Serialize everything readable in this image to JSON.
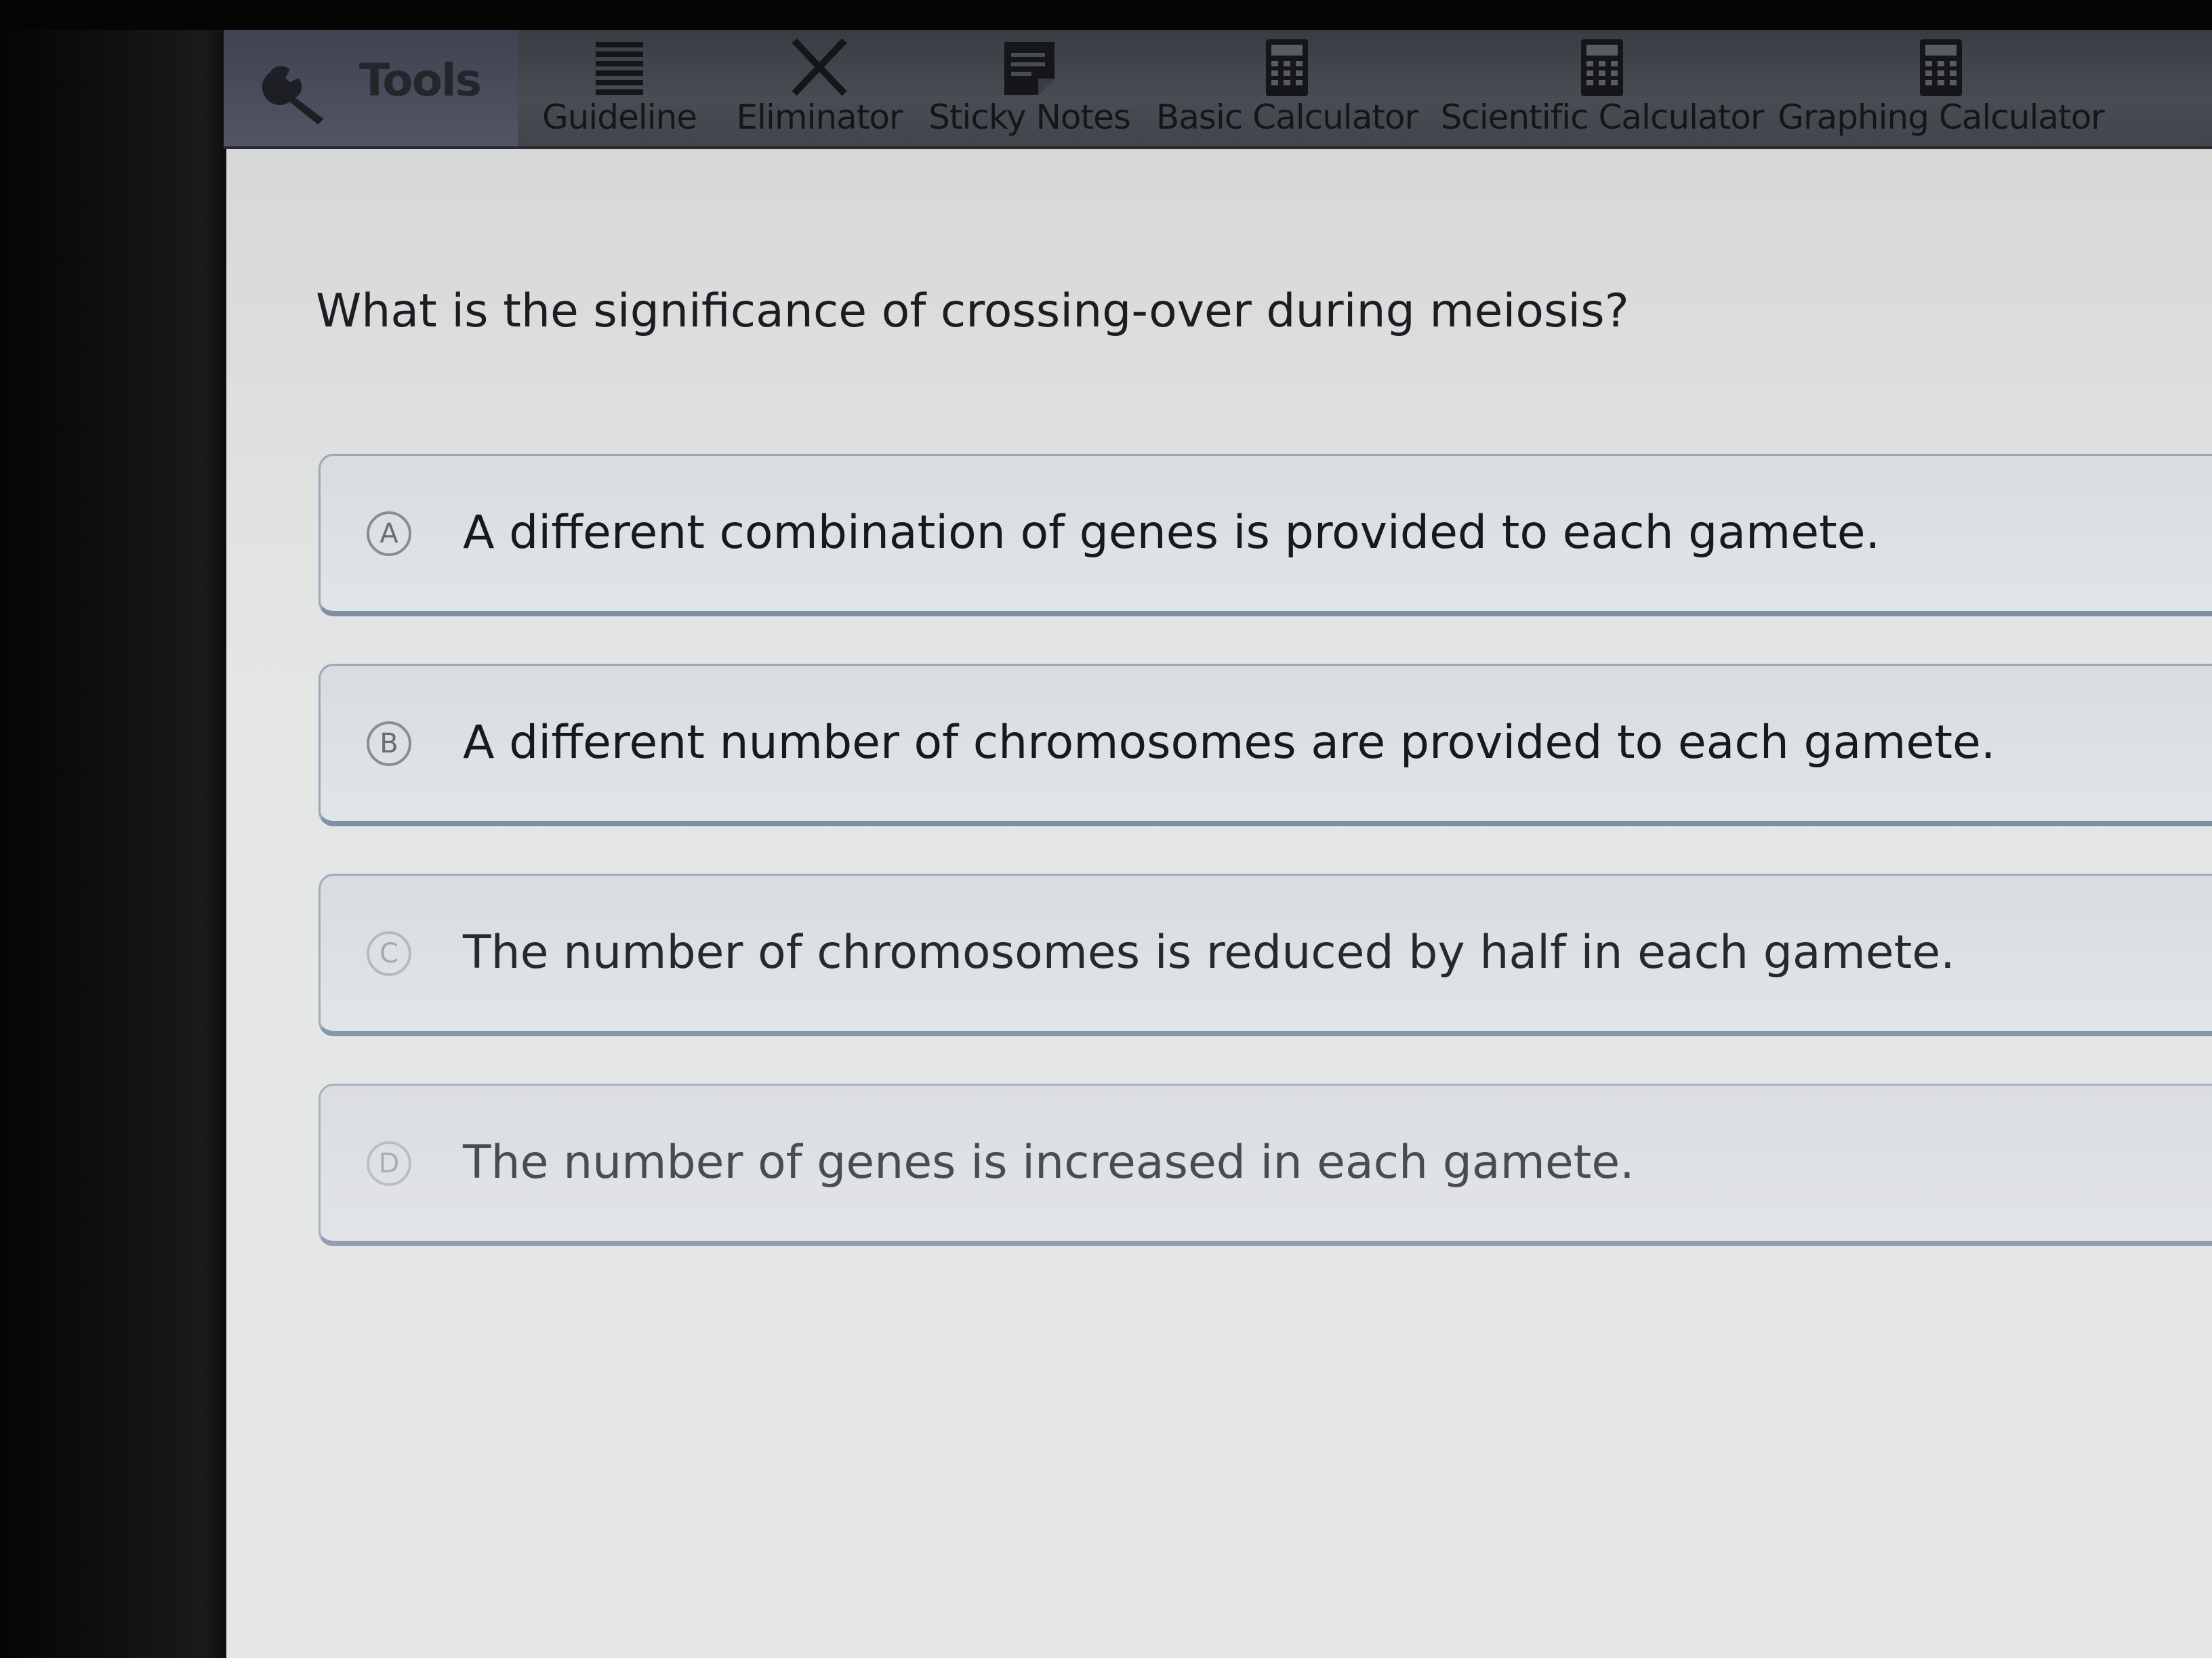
{
  "toolbar": {
    "tools_label": "Tools",
    "items": [
      {
        "label": "Guideline",
        "icon": "guideline-icon"
      },
      {
        "label": "Eliminator",
        "icon": "eliminator-icon"
      },
      {
        "label": "Sticky Notes",
        "icon": "sticky-notes-icon"
      },
      {
        "label": "Basic Calculator",
        "icon": "calculator-icon"
      },
      {
        "label": "Scientific Calculator",
        "icon": "calculator-icon"
      },
      {
        "label": "Graphing Calculator",
        "icon": "calculator-icon"
      }
    ]
  },
  "question": {
    "text": "What is the significance of crossing-over during meiosis?"
  },
  "choices": [
    {
      "letter": "A",
      "text": "A different combination of genes is provided to each gamete."
    },
    {
      "letter": "B",
      "text": "A different number of chromosomes are provided to each gamete."
    },
    {
      "letter": "C",
      "text": "The number of chromosomes is reduced by half in each gamete."
    },
    {
      "letter": "D",
      "text": "The number of genes is increased in each gamete."
    }
  ],
  "colors": {
    "toolbar_bg": "#4a4c54",
    "tools_tab_bg": "#525565",
    "choice_border": "#7f90a4",
    "content_bg": "#e3e5e5"
  }
}
